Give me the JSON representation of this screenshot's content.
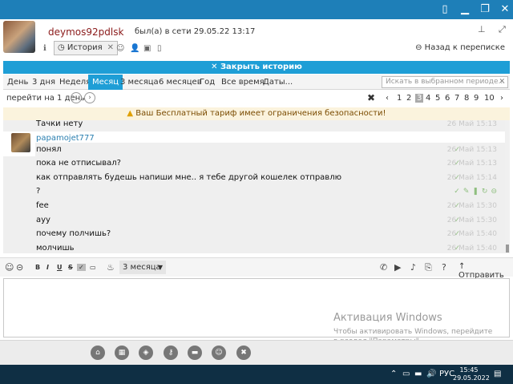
{
  "titlebar": {
    "icons": [
      "panel-icon",
      "minimize-icon",
      "restore-icon",
      "close-icon"
    ]
  },
  "contact": {
    "name": "deymos92pdlsk",
    "status": "был(а) в сети 29.05.22 13:17"
  },
  "toolbar": {
    "info_icon": "info-icon",
    "history_tab": "История",
    "back_label": "Назад к переписке"
  },
  "banner": {
    "close_history": "✕ Закрыть историю"
  },
  "periods": {
    "items": [
      "День",
      "3 дня",
      "Неделя",
      "Месяц",
      "3 месяца",
      "6 месяцев",
      "Год",
      "Все время",
      "Даты..."
    ],
    "active": "Месяц",
    "search_placeholder": "Искать в выбранном периоде..."
  },
  "nav": {
    "goto_label": "перейти на 1 день",
    "pages": [
      "1",
      "2",
      "3",
      "4",
      "5",
      "6",
      "7",
      "8",
      "9",
      "10"
    ],
    "active_page": "3"
  },
  "warning": {
    "text": "Ваш Бесплатный тариф имеет ограничения безопасности!"
  },
  "messages": [
    {
      "text": "Тачки нету",
      "time": "26 Май 15:13"
    },
    {
      "sender": "papamojet777",
      "text": "понял",
      "time": "26 Май 15:13"
    },
    {
      "text": "пока не отписывал?",
      "time": "26 Май 15:13"
    },
    {
      "text": "как отправлять будешь напиши мне.. я тебе другой кошелек отправлю",
      "time": "26 Май 15:14"
    },
    {
      "text": "?",
      "time": ""
    },
    {
      "text": "fee",
      "time": "26 Май 15:30"
    },
    {
      "text": "ayy",
      "time": "26 Май 15:30"
    },
    {
      "text": "почему полчишь?",
      "time": "26 Май 15:40"
    },
    {
      "text": "молчишь",
      "time": "26 Май 15:40"
    }
  ],
  "compose": {
    "period_dropdown": "3 месяца",
    "send_label": "Отправить"
  },
  "watermark": {
    "title": "Активация Windows",
    "text": "Чтобы активировать Windows, перейдите в раздел \"Параметры\"."
  },
  "taskbar": {
    "lang": "РУС",
    "time": "15:45",
    "date": "29.05.2022"
  }
}
